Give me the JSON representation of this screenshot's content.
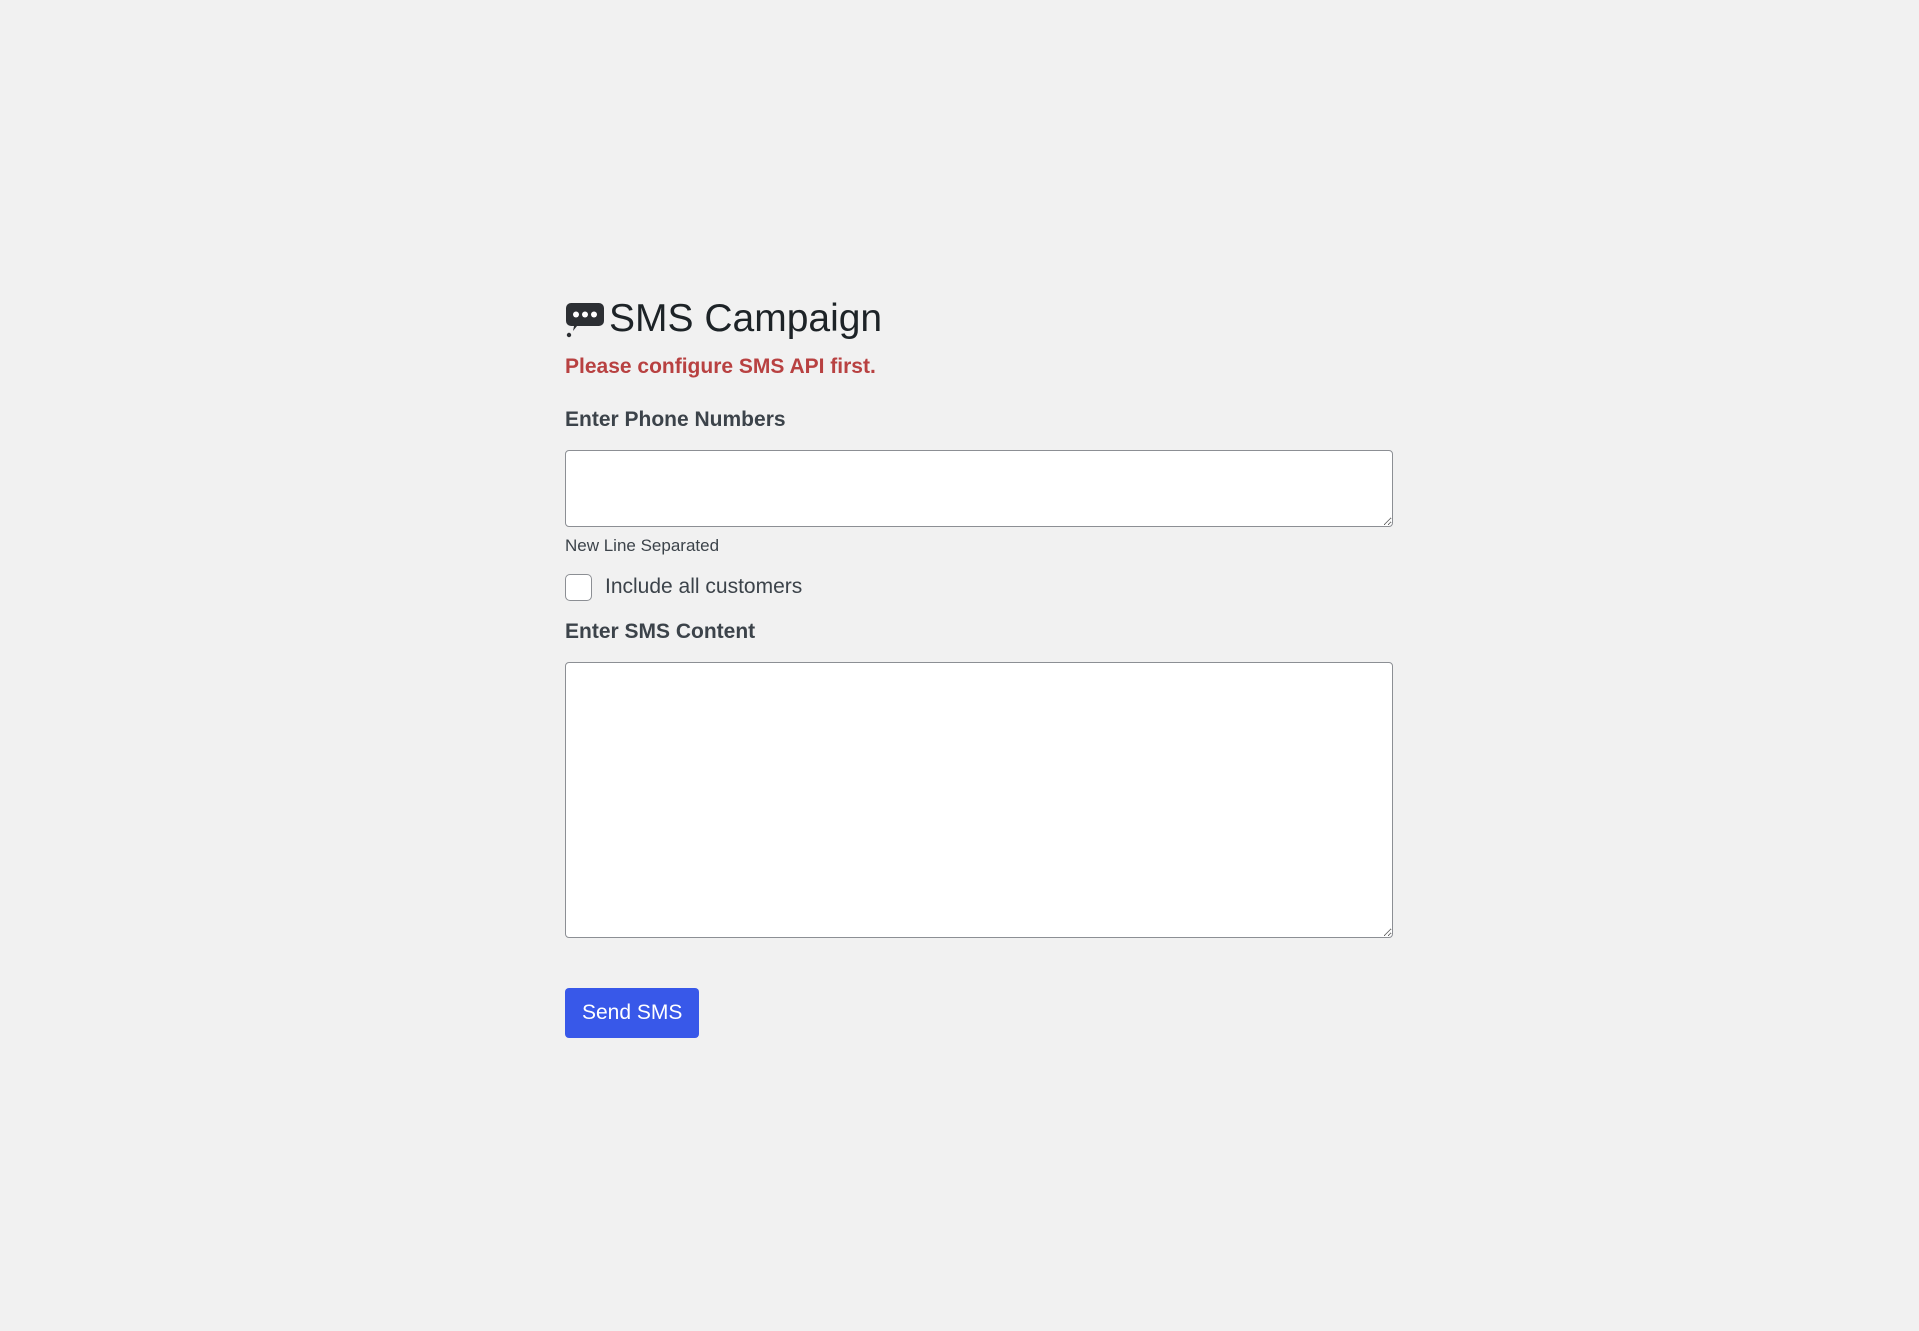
{
  "header": {
    "icon": "speech-bubble-icon",
    "title": "SMS Campaign",
    "notice": "Please configure SMS API first."
  },
  "form": {
    "phone_numbers": {
      "label": "Enter Phone Numbers",
      "value": "",
      "help": "New Line Separated"
    },
    "include_all_customers": {
      "label": "Include all customers",
      "checked": false
    },
    "sms_content": {
      "label": "Enter SMS Content",
      "value": ""
    },
    "submit_label": "Send SMS"
  },
  "colors": {
    "background": "#f1f1f1",
    "error_text": "#b84141",
    "primary_button": "#3858e9"
  }
}
